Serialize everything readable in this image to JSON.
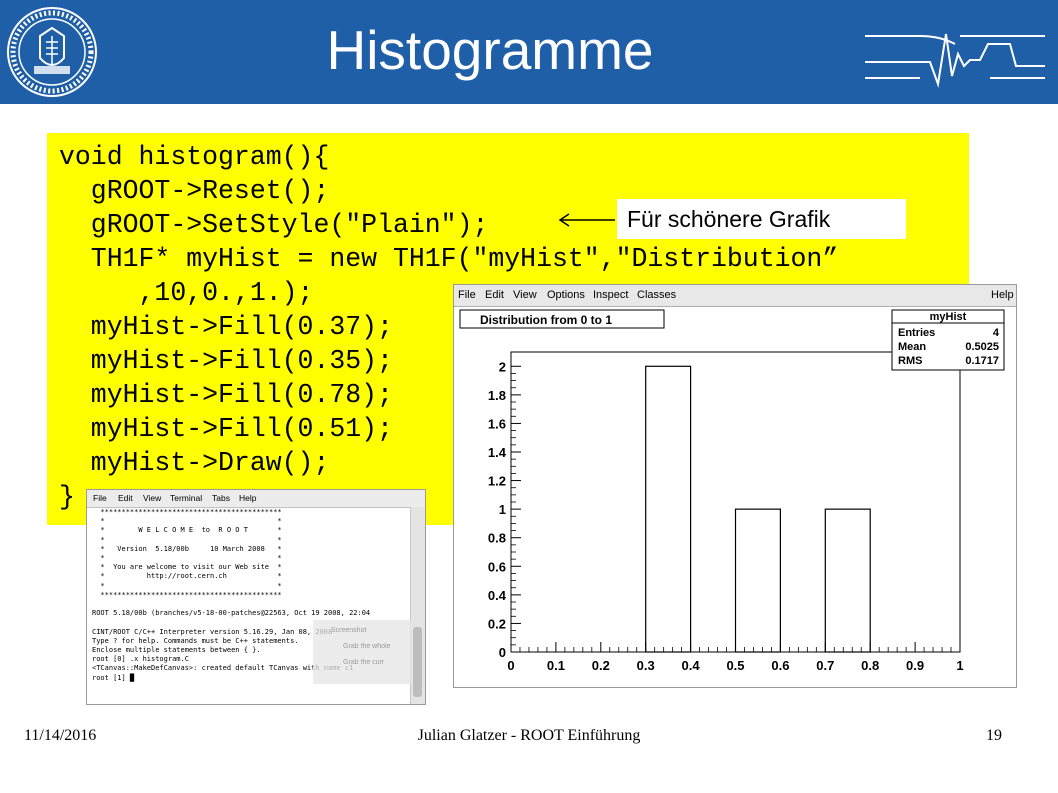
{
  "slide": {
    "title": "Histogramme",
    "callout": "Für schönere Grafik",
    "footer_date": "11/14/2016",
    "footer_center": "Julian Glatzer - ROOT Einführung",
    "page_number": "19"
  },
  "code": [
    "void histogram(){",
    "  gROOT->Reset();",
    "  gROOT->SetStyle(\"Plain\");",
    "  TH1F* myHist = new TH1F(\"myHist\",\"Distribution”",
    "     ,10,0.,1.);",
    "  myHist->Fill(0.37);",
    "  myHist->Fill(0.35);",
    "  myHist->Fill(0.78);",
    "  myHist->Fill(0.51);",
    "  myHist->Draw();",
    "}"
  ],
  "canvas_window": {
    "menu": [
      "File",
      "Edit",
      "View",
      "Options",
      "Inspect",
      "Classes",
      "Help"
    ]
  },
  "chart_data": {
    "type": "bar",
    "title": "Distribution from 0 to 1",
    "bin_edges": [
      0,
      0.1,
      0.2,
      0.3,
      0.4,
      0.5,
      0.6,
      0.7,
      0.8,
      0.9,
      1
    ],
    "values": [
      0,
      0,
      0,
      2,
      0,
      1,
      0,
      1,
      0,
      0
    ],
    "xlim": [
      0,
      1
    ],
    "ylim": [
      0,
      2.1
    ],
    "x_ticks": [
      "0",
      "0.1",
      "0.2",
      "0.3",
      "0.4",
      "0.5",
      "0.6",
      "0.7",
      "0.8",
      "0.9",
      "1"
    ],
    "y_ticks": [
      "0",
      "0.2",
      "0.4",
      "0.6",
      "0.8",
      "1",
      "1.2",
      "1.4",
      "1.6",
      "1.8",
      "2"
    ],
    "stats": {
      "name": "myHist",
      "rows": [
        {
          "label": "Entries",
          "value": "4"
        },
        {
          "label": "Mean",
          "value": "0.5025"
        },
        {
          "label": "RMS",
          "value": "0.1717"
        }
      ]
    }
  },
  "terminal": {
    "menu": [
      "File",
      "Edit",
      "View",
      "Terminal",
      "Tabs",
      "Help"
    ],
    "lines": [
      "  *******************************************",
      "  *                                         *",
      "  *        W E L C O M E  to  R O O T       *",
      "  *                                         *",
      "  *   Version  5.18/00b     10 March 2008   *",
      "  *                                         *",
      "  *  You are welcome to visit our Web site  *",
      "  *          http://root.cern.ch            *",
      "  *                                         *",
      "  *******************************************",
      "",
      "ROOT 5.18/00b (branches/v5-18-00-patches@22563, Oct 19 2008, 22:04",
      "",
      "CINT/ROOT C/C++ Interpreter version 5.16.29, Jan 08, 2008",
      "Type ? for help. Commands must be C++ statements.",
      "Enclose multiple statements between { }.",
      "root [0] .x histogram.C",
      "<TCanvas::MakeDefCanvas>: created default TCanvas with name c1",
      "root [1] █"
    ],
    "overlay": [
      "Screenshot",
      "Grab the whole",
      "Grab the curr"
    ]
  }
}
